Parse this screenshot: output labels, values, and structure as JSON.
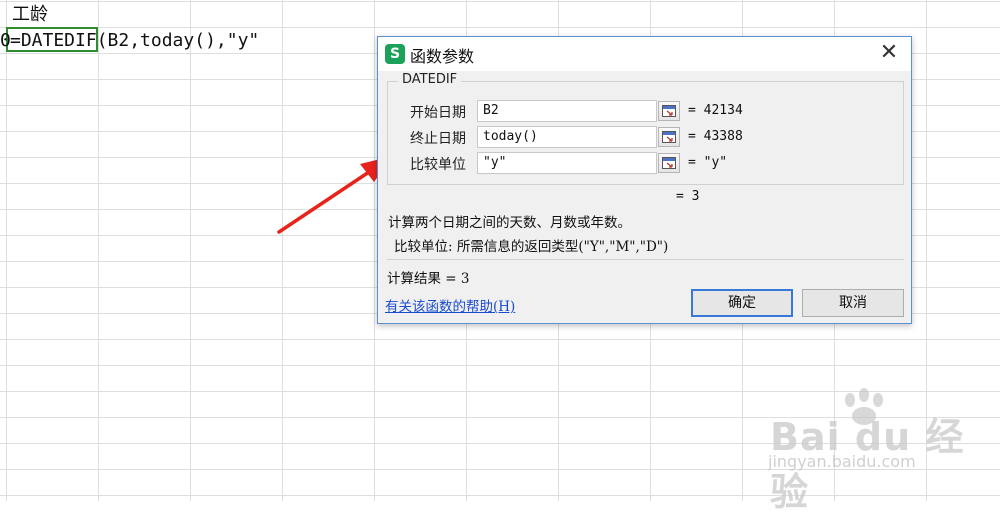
{
  "sheet": {
    "header_cell": "工龄",
    "row_number": "0",
    "formula": "=DATEDIF(B2,today(),\"y\""
  },
  "dialog": {
    "title": "函数参数",
    "app_icon": "S",
    "close": "✕",
    "function_name": "DATEDIF",
    "params": [
      {
        "label": "开始日期",
        "value": "B2",
        "result": "= 42134"
      },
      {
        "label": "终止日期",
        "value": "today()",
        "result": "= 43388"
      },
      {
        "label": "比较单位",
        "value": "\"y\"",
        "result": "= \"y\""
      }
    ],
    "formula_result": "= 3",
    "description": "计算两个日期之间的天数、月数或年数。",
    "param_description": "比较单位: 所需信息的返回类型(\"Y\",\"M\",\"D\")",
    "calc_result": "计算结果 = 3",
    "help_link": "有关该函数的帮助(H)",
    "ok_label": "确定",
    "cancel_label": "取消"
  },
  "watermark": {
    "brand": "Bai du 经验",
    "url": "jingyan.baidu.com"
  },
  "colors": {
    "arrow": "#e8231b",
    "dialog_border": "#5b8fd6",
    "link": "#1a4bcf",
    "active_cell": "#2e8b2e"
  }
}
